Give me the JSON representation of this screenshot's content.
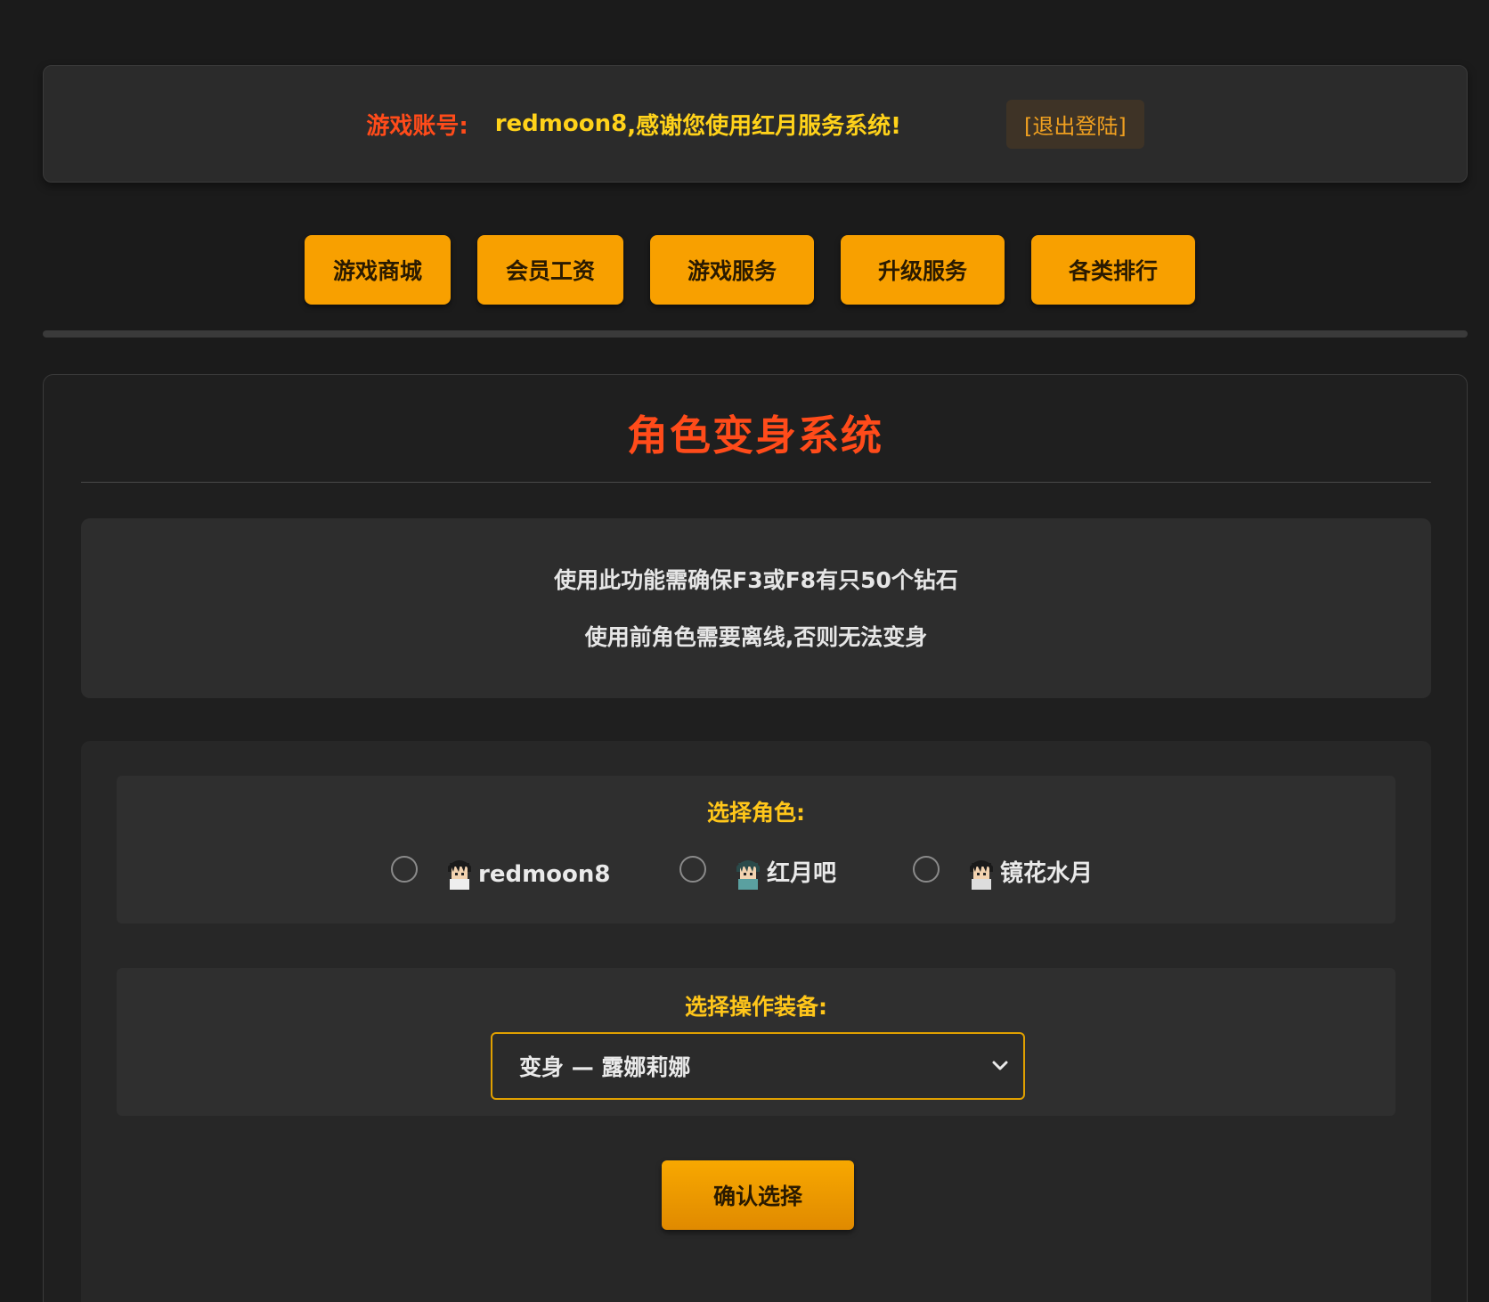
{
  "account": {
    "label": "游戏账号:",
    "username": "redmoon8",
    "thanks": ",感谢您使用红月服务系统!",
    "logout": "[退出登陆]"
  },
  "nav": [
    {
      "label": "游戏商城"
    },
    {
      "label": "会员工资"
    },
    {
      "label": "游戏服务"
    },
    {
      "label": "升级服务"
    },
    {
      "label": "各类排行"
    }
  ],
  "main": {
    "title": "角色变身系统",
    "notices": [
      "使用此功能需确保F3或F8有只50个钻石",
      "使用前角色需要离线,否则无法变身"
    ],
    "role_label": "选择角色:",
    "roles": [
      {
        "name": "redmoon8",
        "selected": false
      },
      {
        "name": "红月吧",
        "selected": false
      },
      {
        "name": "镜花水月",
        "selected": false
      }
    ],
    "equip_label": "选择操作装备:",
    "equip_selected": "变身 — 露娜莉娜",
    "confirm": "确认选择"
  },
  "colors": {
    "accent": "#f8a000",
    "title": "#ff4b1a",
    "label": "#ffc61a",
    "background": "#1b1b1b"
  }
}
